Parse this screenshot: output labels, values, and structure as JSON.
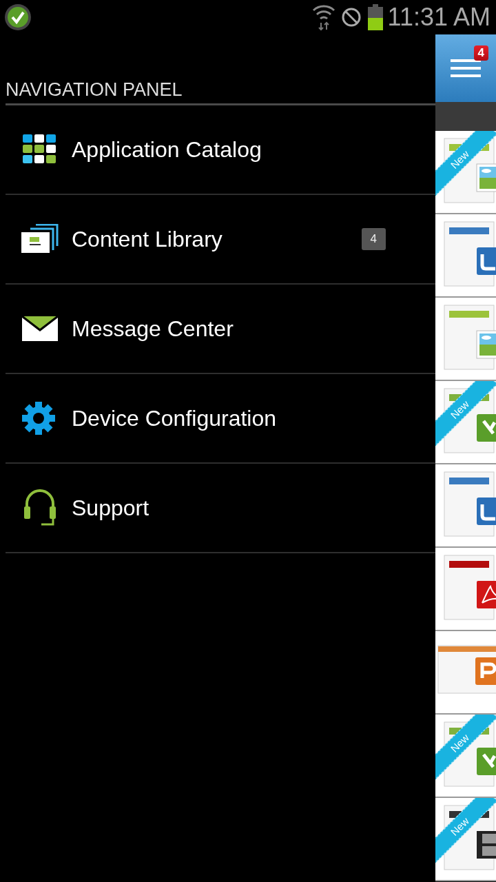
{
  "status_bar": {
    "time": "11:31 AM"
  },
  "navigation": {
    "title": "NAVIGATION PANEL",
    "items": [
      {
        "kind": "catalog",
        "label": "Application Catalog"
      },
      {
        "kind": "library",
        "label": "Content Library",
        "badge": "4"
      },
      {
        "kind": "message",
        "label": "Message Center"
      },
      {
        "kind": "config",
        "label": "Device Configuration"
      },
      {
        "kind": "support",
        "label": "Support"
      }
    ]
  },
  "content_strip": {
    "menu_badge": "4",
    "tiles": [
      {
        "kind": "image",
        "ribbon": "New"
      },
      {
        "kind": "word"
      },
      {
        "kind": "image"
      },
      {
        "kind": "excel",
        "ribbon": "New"
      },
      {
        "kind": "word"
      },
      {
        "kind": "pdf"
      },
      {
        "kind": "powerpoint"
      },
      {
        "kind": "excel",
        "ribbon": "New"
      },
      {
        "kind": "video",
        "ribbon": "New"
      }
    ]
  }
}
